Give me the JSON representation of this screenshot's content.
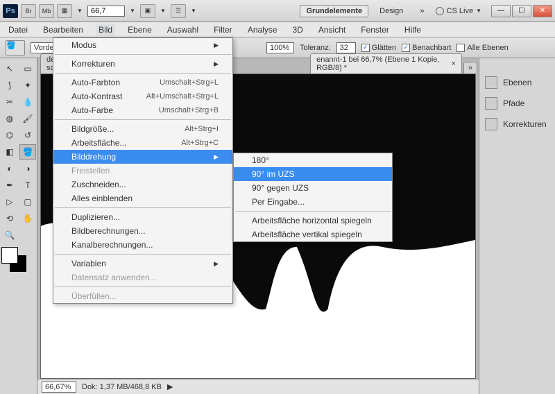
{
  "titlebar": {
    "ps": "Ps",
    "br": "Br",
    "mb": "Mb",
    "zoom_display": "66,7",
    "workspace_active": "Grundelemente",
    "workspace_secondary": "Design",
    "cslive": "CS Live"
  },
  "menubar": [
    "Datei",
    "Bearbeiten",
    "Bild",
    "Ebene",
    "Auswahl",
    "Filter",
    "Analyse",
    "3D",
    "Ansicht",
    "Fenster",
    "Hilfe"
  ],
  "menubar_open_index": 2,
  "options": {
    "label1": "Vordergrun",
    "zoom_value": "100%",
    "tolerance_label": "Toleranz:",
    "tolerance_value": "32",
    "cb_glaetten": "Glätten",
    "cb_benachbart": "Benachbart",
    "cb_alle": "Alle Ebenen",
    "cb_glaetten_checked": true,
    "cb_benachbart_checked": true,
    "cb_alle_checked": false
  },
  "tabs": {
    "left_truncated": "deffekt-sour",
    "active": "enannt-1 bei 66,7% (Ebene 1 Kopie, RGB/8) *"
  },
  "panels": {
    "ebenen": "Ebenen",
    "pfade": "Pfade",
    "korrekturen": "Korrekturen"
  },
  "status": {
    "zoom": "66,67%",
    "doc": "Dok: 1,37 MB/468,8 KB"
  },
  "menu_bild": [
    {
      "type": "sub",
      "label": "Modus",
      "disabled": false,
      "has_sub": true
    },
    {
      "type": "sep"
    },
    {
      "type": "sub",
      "label": "Korrekturen",
      "disabled": false,
      "has_sub": true
    },
    {
      "type": "sep"
    },
    {
      "type": "item",
      "label": "Auto-Farbton",
      "shortcut": "Umschalt+Strg+L"
    },
    {
      "type": "item",
      "label": "Auto-Kontrast",
      "shortcut": "Alt+Umschalt+Strg+L"
    },
    {
      "type": "item",
      "label": "Auto-Farbe",
      "shortcut": "Umschalt+Strg+B"
    },
    {
      "type": "sep"
    },
    {
      "type": "item",
      "label": "Bildgröße...",
      "shortcut": "Alt+Strg+I"
    },
    {
      "type": "item",
      "label": "Arbeitsfläche...",
      "shortcut": "Alt+Strg+C"
    },
    {
      "type": "sub",
      "label": "Bilddrehung",
      "highlight": true,
      "has_sub": true
    },
    {
      "type": "item",
      "label": "Freistellen",
      "disabled": true
    },
    {
      "type": "item",
      "label": "Zuschneiden..."
    },
    {
      "type": "item",
      "label": "Alles einblenden"
    },
    {
      "type": "sep"
    },
    {
      "type": "item",
      "label": "Duplizieren..."
    },
    {
      "type": "item",
      "label": "Bildberechnungen..."
    },
    {
      "type": "item",
      "label": "Kanalberechnungen..."
    },
    {
      "type": "sep"
    },
    {
      "type": "sub",
      "label": "Variablen",
      "disabled": false,
      "has_sub": true
    },
    {
      "type": "item",
      "label": "Datensatz anwenden...",
      "disabled": true
    },
    {
      "type": "sep"
    },
    {
      "type": "item",
      "label": "Überfüllen...",
      "disabled": true
    }
  ],
  "submenu_drehung": [
    {
      "label": "180°"
    },
    {
      "label": "90° im UZS",
      "highlight": true
    },
    {
      "label": "90° gegen UZS"
    },
    {
      "label": "Per Eingabe..."
    },
    {
      "type": "sep"
    },
    {
      "label": "Arbeitsfläche horizontal spiegeln"
    },
    {
      "label": "Arbeitsfläche vertikal spiegeln"
    }
  ]
}
